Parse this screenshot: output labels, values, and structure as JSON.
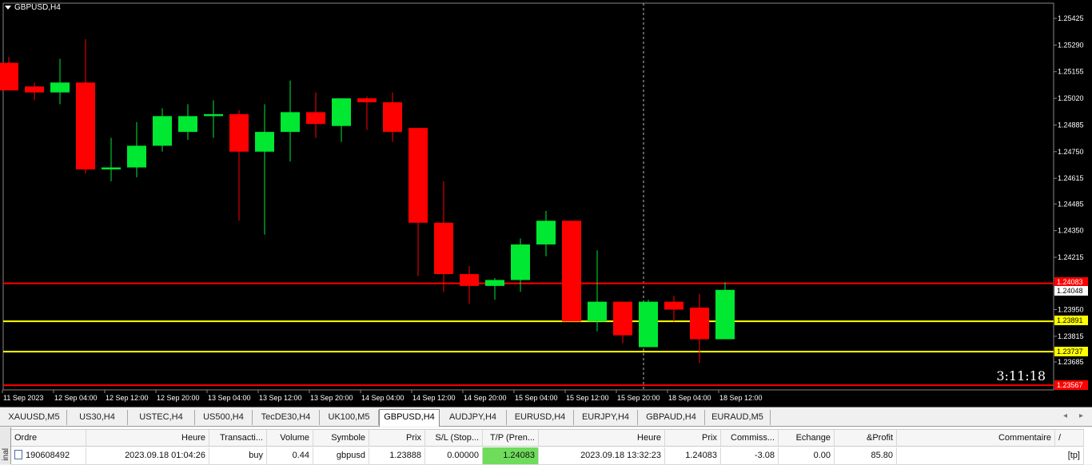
{
  "chart": {
    "symbol_title": "GBPUSD,H4",
    "countdown": "3:11:18",
    "colors": {
      "background": "#000000",
      "bull": "#00e832",
      "bear": "#ff0000",
      "red_line": "#ff0000",
      "yellow_line": "#ffff00",
      "grid_crosshair": "#bbbbbb"
    },
    "price_axis_labels": [
      "1.25425",
      "1.25290",
      "1.25155",
      "1.25020",
      "1.24885",
      "1.24750",
      "1.24615",
      "1.24485",
      "1.24350",
      "1.24215",
      "1.23950",
      "1.23815",
      "1.23685"
    ],
    "level_labels": [
      {
        "value": "1.24083",
        "style": "red"
      },
      {
        "value": "1.24048",
        "style": "white"
      },
      {
        "value": "1.23891",
        "style": "yellow"
      },
      {
        "value": "1.23737",
        "style": "yellow"
      },
      {
        "value": "1.23567",
        "style": "red"
      }
    ],
    "time_axis_labels": [
      "11 Sep 2023",
      "12 Sep 04:00",
      "12 Sep 12:00",
      "12 Sep 20:00",
      "13 Sep 04:00",
      "13 Sep 12:00",
      "13 Sep 20:00",
      "14 Sep 04:00",
      "14 Sep 12:00",
      "14 Sep 20:00",
      "15 Sep 04:00",
      "15 Sep 12:00",
      "15 Sep 20:00",
      "18 Sep 04:00",
      "18 Sep 12:00"
    ],
    "candles": [
      {
        "o": 1.252,
        "h": 1.2523,
        "l": 1.2506,
        "c": 1.2506
      },
      {
        "o": 1.2508,
        "h": 1.251,
        "l": 1.2501,
        "c": 1.2505
      },
      {
        "o": 1.2505,
        "h": 1.2522,
        "l": 1.2499,
        "c": 1.251
      },
      {
        "o": 1.251,
        "h": 1.2532,
        "l": 1.2464,
        "c": 1.2466
      },
      {
        "o": 1.2466,
        "h": 1.2482,
        "l": 1.246,
        "c": 1.2467
      },
      {
        "o": 1.2467,
        "h": 1.249,
        "l": 1.2462,
        "c": 1.2478
      },
      {
        "o": 1.2478,
        "h": 1.2497,
        "l": 1.2475,
        "c": 1.2493
      },
      {
        "o": 1.2485,
        "h": 1.2499,
        "l": 1.2481,
        "c": 1.2493
      },
      {
        "o": 1.2493,
        "h": 1.2501,
        "l": 1.2482,
        "c": 1.2494
      },
      {
        "o": 1.2494,
        "h": 1.2496,
        "l": 1.244,
        "c": 1.2475
      },
      {
        "o": 1.2475,
        "h": 1.2499,
        "l": 1.2433,
        "c": 1.2485
      },
      {
        "o": 1.2485,
        "h": 1.2511,
        "l": 1.247,
        "c": 1.2495
      },
      {
        "o": 1.2495,
        "h": 1.2505,
        "l": 1.2482,
        "c": 1.2489
      },
      {
        "o": 1.2488,
        "h": 1.25,
        "l": 1.248,
        "c": 1.2502
      },
      {
        "o": 1.2502,
        "h": 1.2503,
        "l": 1.2486,
        "c": 1.25
      },
      {
        "o": 1.25,
        "h": 1.2505,
        "l": 1.248,
        "c": 1.2485
      },
      {
        "o": 1.2487,
        "h": 1.2487,
        "l": 1.2412,
        "c": 1.2439
      },
      {
        "o": 1.2439,
        "h": 1.246,
        "l": 1.2404,
        "c": 1.2413
      },
      {
        "o": 1.2413,
        "h": 1.2417,
        "l": 1.2398,
        "c": 1.2407
      },
      {
        "o": 1.2407,
        "h": 1.2411,
        "l": 1.24,
        "c": 1.241
      },
      {
        "o": 1.241,
        "h": 1.2431,
        "l": 1.2404,
        "c": 1.2428
      },
      {
        "o": 1.2428,
        "h": 1.2445,
        "l": 1.2422,
        "c": 1.244
      },
      {
        "o": 1.244,
        "h": 1.244,
        "l": 1.2389,
        "c": 1.2389
      },
      {
        "o": 1.2389,
        "h": 1.2425,
        "l": 1.2384,
        "c": 1.2399
      },
      {
        "o": 1.2399,
        "h": 1.2399,
        "l": 1.2378,
        "c": 1.2382
      },
      {
        "o": 1.2376,
        "h": 1.24,
        "l": 1.2376,
        "c": 1.2399
      },
      {
        "o": 1.2399,
        "h": 1.2402,
        "l": 1.2389,
        "c": 1.2395
      },
      {
        "o": 1.2396,
        "h": 1.2403,
        "l": 1.2368,
        "c": 1.238
      },
      {
        "o": 1.238,
        "h": 1.2409,
        "l": 1.238,
        "c": 1.2405
      }
    ]
  },
  "tabs": [
    "XAUUSD,M5",
    "US30,H4",
    "USTEC,H4",
    "US500,H4",
    "TecDE30,H4",
    "UK100,M5",
    "GBPUSD,H4",
    "AUDJPY,H4",
    "EURUSD,H4",
    "EURJPY,H4",
    "GBPAUD,H4",
    "EURAUD,M5"
  ],
  "active_tab": "GBPUSD,H4",
  "terminal": {
    "side_label": "inal",
    "headers": [
      "Ordre",
      "Heure",
      "Transacti...",
      "Volume",
      "Symbole",
      "Prix",
      "S/L (Stop...",
      "T/P (Pren...",
      "Heure",
      "Prix",
      "Commiss...",
      "Echange",
      "&Profit",
      "Commentaire",
      "/"
    ],
    "row": [
      "190608492",
      "2023.09.18 01:04:26",
      "buy",
      "0.44",
      "gbpusd",
      "1.23888",
      "0.00000",
      "1.24083",
      "2023.09.18 13:32:23",
      "1.24083",
      "-3.08",
      "0.00",
      "85.80",
      "[tp]"
    ]
  }
}
